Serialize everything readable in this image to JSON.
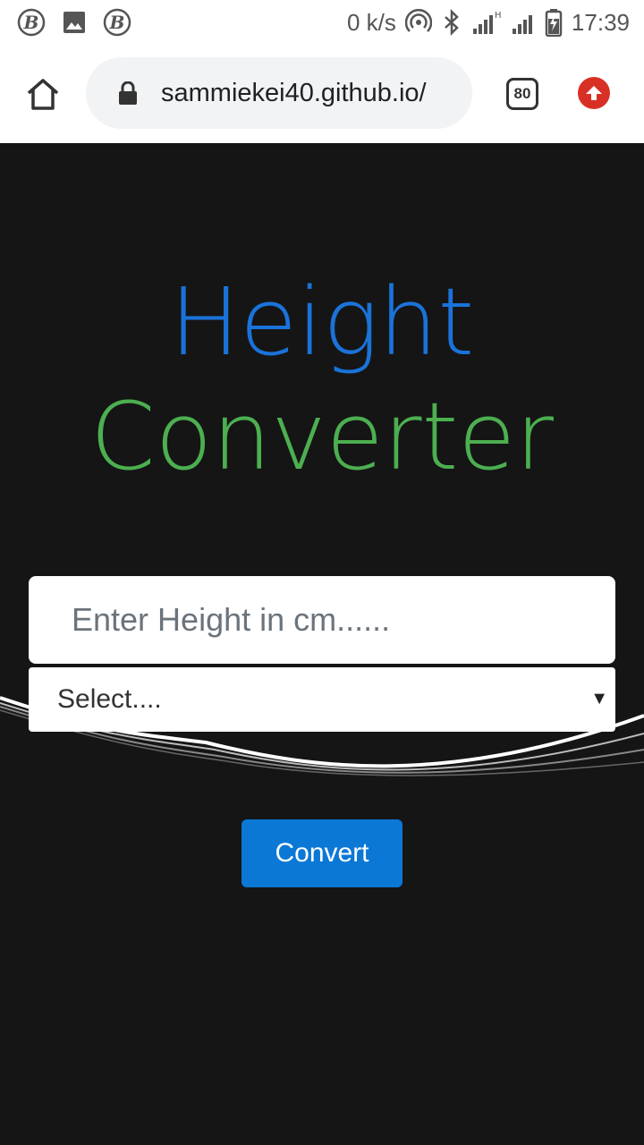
{
  "status_bar": {
    "net_speed": "0 k/s",
    "network_type": "H+",
    "time": "17:39",
    "left_icons": [
      "b-app-icon",
      "image-icon",
      "b-app-icon"
    ],
    "right_icons": [
      "hotspot-icon",
      "bluetooth-icon",
      "signal-icon",
      "signal-icon",
      "battery-charging-icon"
    ]
  },
  "browser": {
    "url": "sammiekei40.github.io/",
    "tab_count": "80",
    "home_icon": "home-icon",
    "lock_icon": "lock-icon",
    "update_icon": "update-arrow-icon"
  },
  "page": {
    "title_line1": "Height",
    "title_line2": "Converter",
    "title_line1_color": "#1a73d9",
    "title_line2_color": "#4caf50",
    "input_placeholder": "Enter Height in cm......",
    "select_value": "Select....",
    "convert_label": "Convert",
    "button_color": "#0b78d6",
    "background_color": "#151515"
  }
}
